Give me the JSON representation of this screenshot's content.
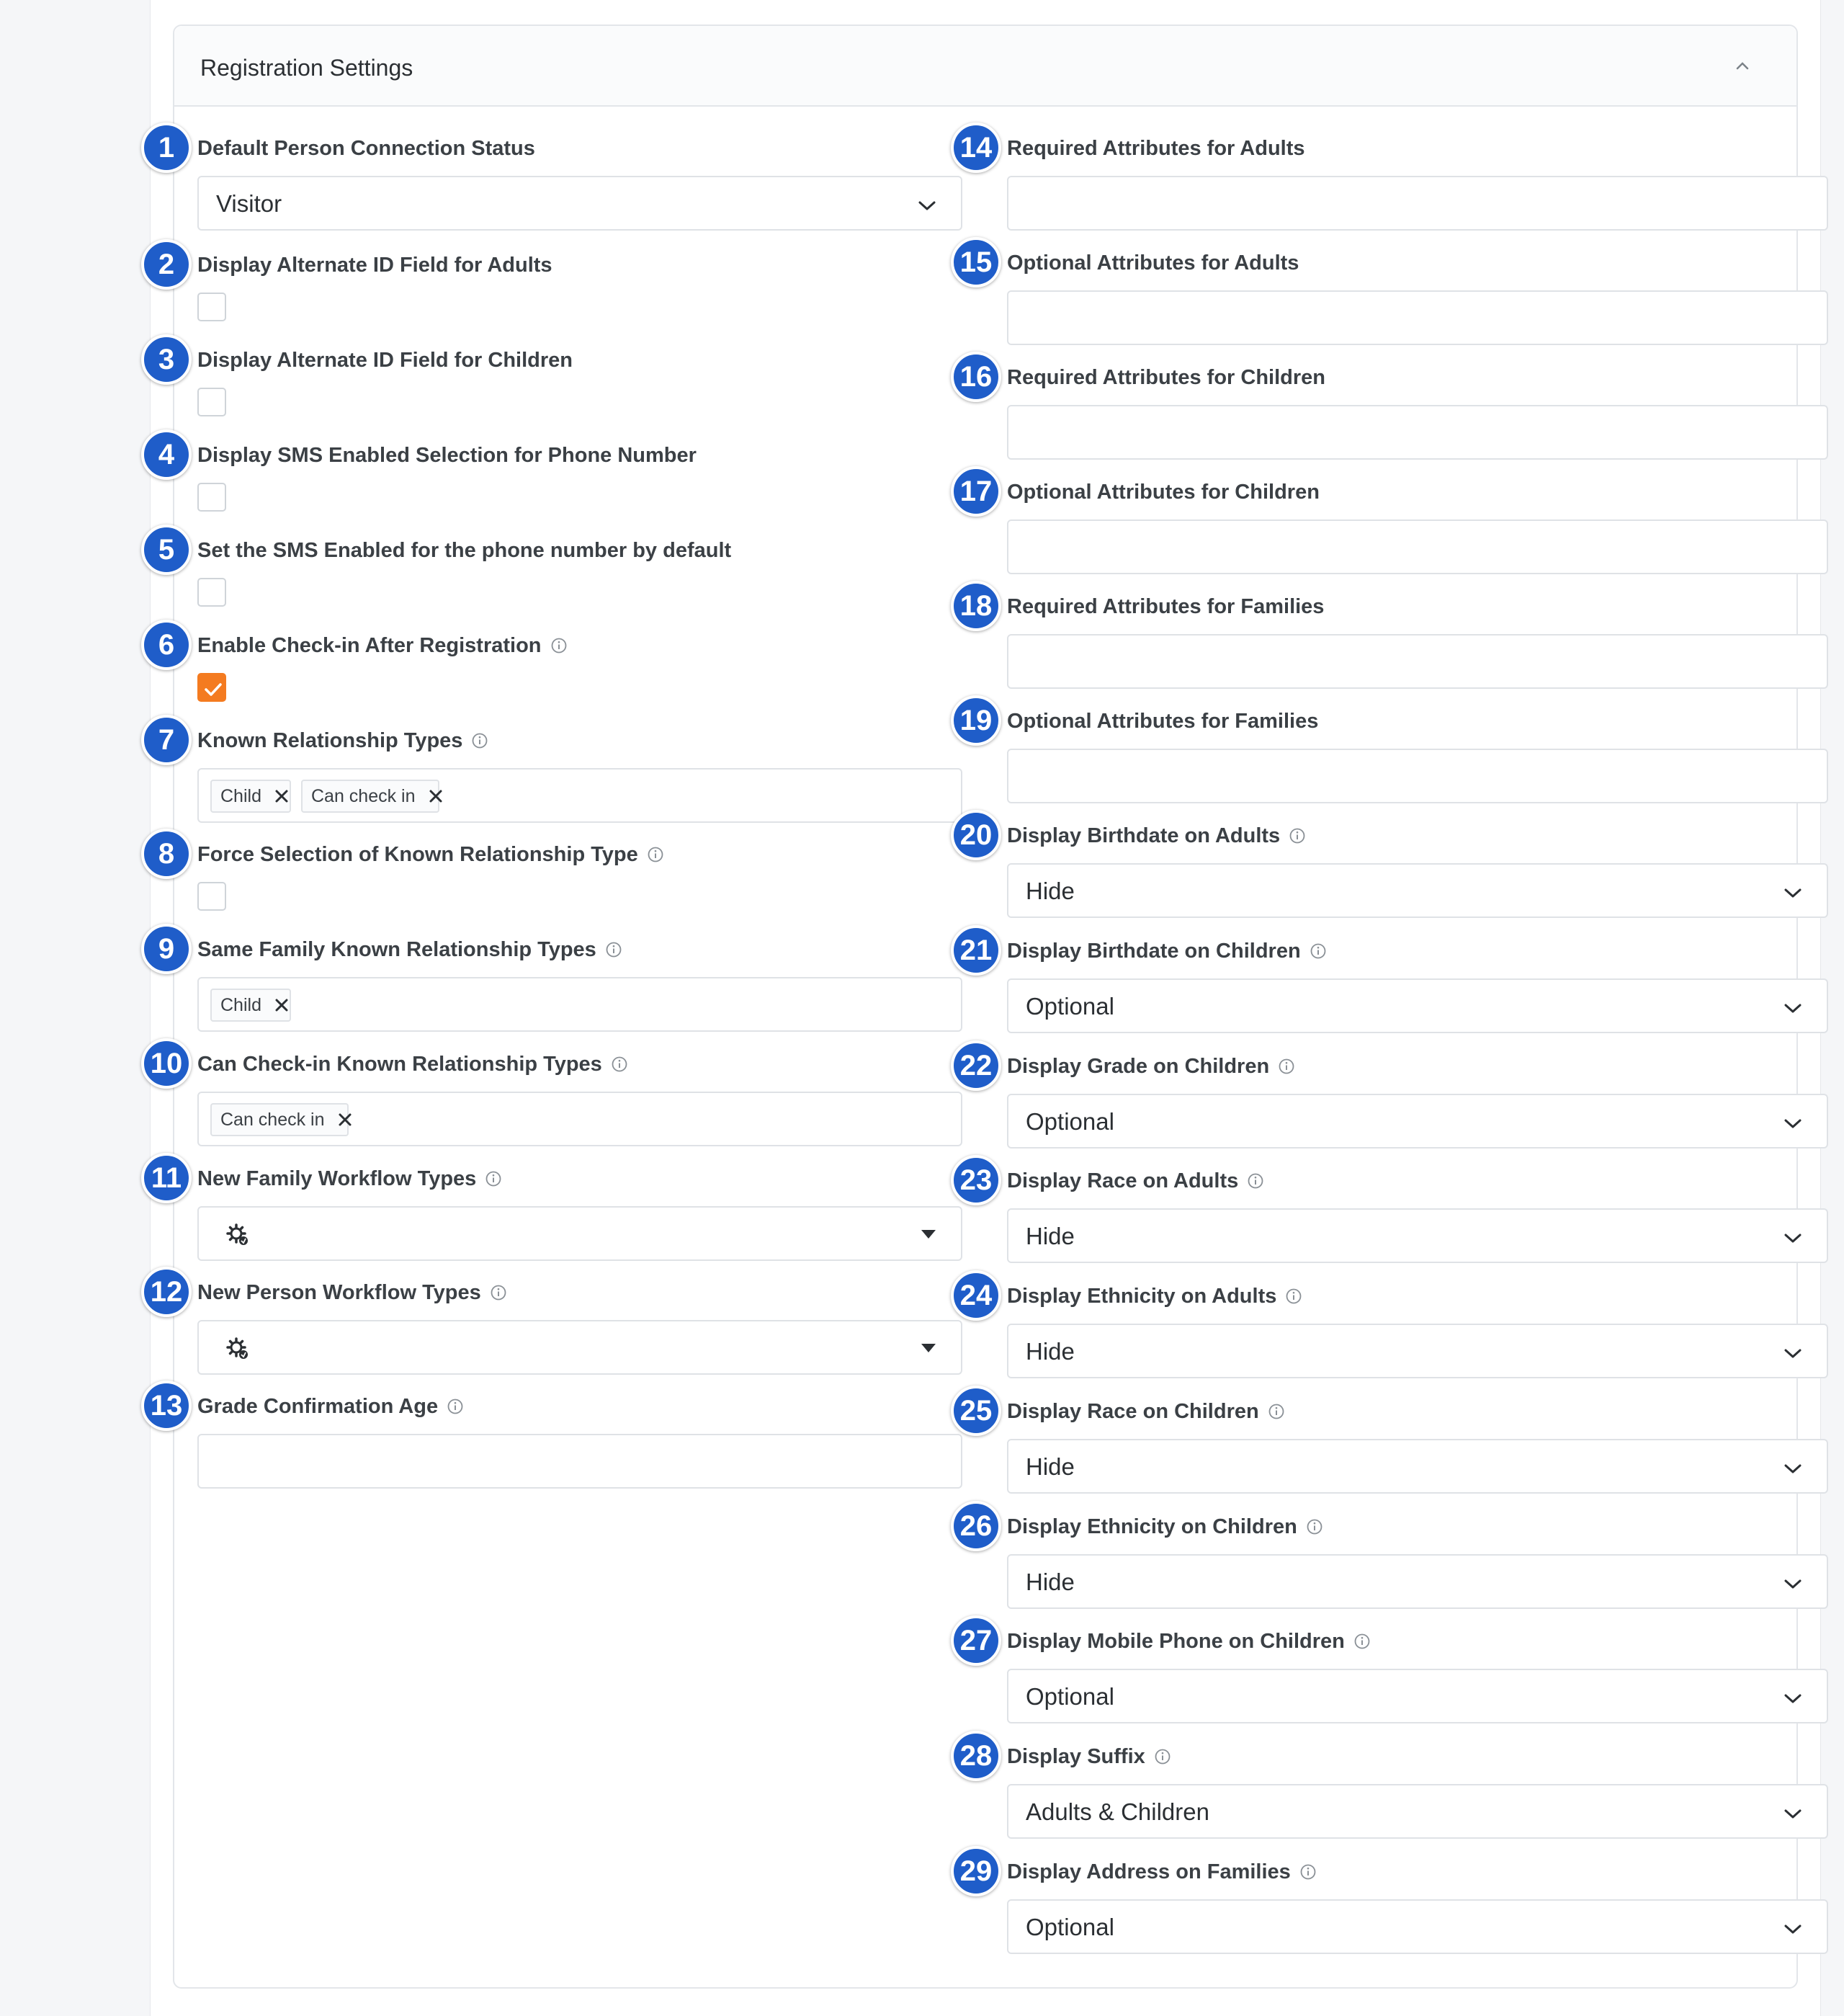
{
  "panel": {
    "title": "Registration Settings"
  },
  "colors": {
    "badge": "#1f5dc9",
    "checkbox_checked": "#f47b20"
  },
  "left_fields": [
    {
      "number": "1",
      "label": "Default Person Connection Status",
      "type": "select",
      "value": "Visitor"
    },
    {
      "number": "2",
      "label": "Display Alternate ID Field for Adults",
      "type": "checkbox",
      "checked": false
    },
    {
      "number": "3",
      "label": "Display Alternate ID Field for Children",
      "type": "checkbox",
      "checked": false
    },
    {
      "number": "4",
      "label": "Display SMS Enabled Selection for Phone Number",
      "type": "checkbox",
      "checked": false
    },
    {
      "number": "5",
      "label": "Set the SMS Enabled for the phone number by default",
      "type": "checkbox",
      "checked": false
    },
    {
      "number": "6",
      "label": "Enable Check-in After Registration",
      "type": "checkbox",
      "checked": true,
      "info": true
    },
    {
      "number": "7",
      "label": "Known Relationship Types",
      "type": "tags",
      "tags": [
        "Child",
        "Can check in"
      ],
      "info": true
    },
    {
      "number": "8",
      "label": "Force Selection of Known Relationship Type",
      "type": "checkbox",
      "checked": false,
      "info": true
    },
    {
      "number": "9",
      "label": "Same Family Known Relationship Types",
      "type": "tags",
      "tags": [
        "Child"
      ],
      "info": true
    },
    {
      "number": "10",
      "label": "Can Check-in Known Relationship Types",
      "type": "tags",
      "tags": [
        "Can check in"
      ],
      "info": true
    },
    {
      "number": "11",
      "label": "New Family Workflow Types",
      "type": "workflow",
      "info": true
    },
    {
      "number": "12",
      "label": "New Person Workflow Types",
      "type": "workflow",
      "info": true
    },
    {
      "number": "13",
      "label": "Grade Confirmation Age",
      "type": "text",
      "value": "",
      "info": true
    }
  ],
  "right_fields": [
    {
      "number": "14",
      "label": "Required Attributes for Adults",
      "type": "text",
      "value": ""
    },
    {
      "number": "15",
      "label": "Optional Attributes for Adults",
      "type": "text",
      "value": ""
    },
    {
      "number": "16",
      "label": "Required Attributes for Children",
      "type": "text",
      "value": ""
    },
    {
      "number": "17",
      "label": "Optional Attributes for Children",
      "type": "text",
      "value": ""
    },
    {
      "number": "18",
      "label": "Required Attributes for Families",
      "type": "text",
      "value": ""
    },
    {
      "number": "19",
      "label": "Optional Attributes for Families",
      "type": "text",
      "value": ""
    },
    {
      "number": "20",
      "label": "Display Birthdate on Adults",
      "type": "select",
      "value": "Hide",
      "info": true
    },
    {
      "number": "21",
      "label": "Display Birthdate on Children",
      "type": "select",
      "value": "Optional",
      "info": true
    },
    {
      "number": "22",
      "label": "Display Grade on Children",
      "type": "select",
      "value": "Optional",
      "info": true
    },
    {
      "number": "23",
      "label": "Display Race on Adults",
      "type": "select",
      "value": "Hide",
      "info": true
    },
    {
      "number": "24",
      "label": "Display Ethnicity on Adults",
      "type": "select",
      "value": "Hide",
      "info": true
    },
    {
      "number": "25",
      "label": "Display Race on Children",
      "type": "select",
      "value": "Hide",
      "info": true
    },
    {
      "number": "26",
      "label": "Display Ethnicity on Children",
      "type": "select",
      "value": "Hide",
      "info": true
    },
    {
      "number": "27",
      "label": "Display Mobile Phone on Children",
      "type": "select",
      "value": "Optional",
      "info": true
    },
    {
      "number": "28",
      "label": "Display Suffix",
      "type": "select",
      "value": "Adults & Children",
      "info": true
    },
    {
      "number": "29",
      "label": "Display Address on Families",
      "type": "select",
      "value": "Optional",
      "info": true
    }
  ]
}
